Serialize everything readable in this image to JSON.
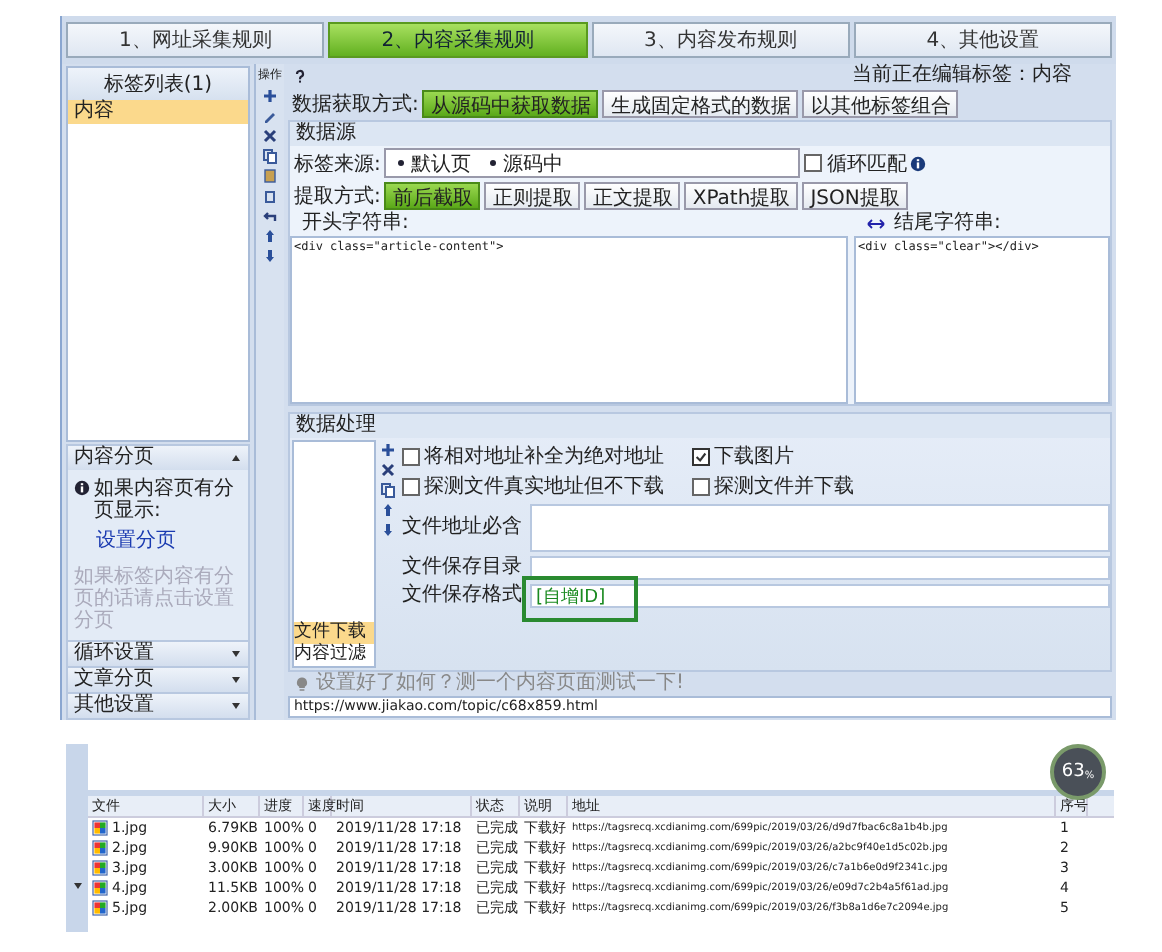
{
  "steps": [
    {
      "label": "1、网址采集规则",
      "selected": false
    },
    {
      "label": "2、内容采集规则",
      "selected": true
    },
    {
      "label": "3、内容发布规则",
      "selected": false
    },
    {
      "label": "4、其他设置",
      "selected": false
    }
  ],
  "tag_list": {
    "title": "标签列表(1)",
    "items": [
      {
        "label": "内容",
        "selected": true
      }
    ]
  },
  "toolbar_label": "操作",
  "editing_status": "当前正在编辑标签：内容",
  "data_mode": {
    "label": "数据获取方式:",
    "options": [
      {
        "label": "从源码中获取数据",
        "selected": true
      },
      {
        "label": "生成固定格式的数据",
        "selected": false
      },
      {
        "label": "以其他标签组合",
        "selected": false
      }
    ]
  },
  "data_source": {
    "title": "数据源",
    "source_label": "标签来源:",
    "sources": [
      "默认页",
      "源码中"
    ],
    "loop_match": {
      "label": "循环匹配",
      "checked": false
    },
    "extract_label": "提取方式:",
    "methods": [
      {
        "label": "前后截取",
        "selected": true
      },
      {
        "label": "正则提取",
        "selected": false
      },
      {
        "label": "正文提取",
        "selected": false
      },
      {
        "label": "XPath提取",
        "selected": false
      },
      {
        "label": "JSON提取",
        "selected": false
      }
    ],
    "start": {
      "label": "开头字符串:",
      "value": "<div class=\"article-content\">"
    },
    "end": {
      "label": "结尾字符串:",
      "value": "<div class=\"clear\"></div>"
    }
  },
  "processing": {
    "title": "数据处理",
    "items": [
      {
        "label": "文件下载",
        "selected": true
      },
      {
        "label": "内容过滤",
        "selected": false
      }
    ],
    "options": [
      {
        "label": "将相对地址补全为绝对地址",
        "checked": false
      },
      {
        "label": "下载图片",
        "checked": true
      },
      {
        "label": "探测文件真实地址但不下载",
        "checked": false
      },
      {
        "label": "探测文件并下载",
        "checked": false
      }
    ],
    "fields": [
      {
        "label": "文件地址必含",
        "highlighted": false
      },
      {
        "label": "文件保存目录",
        "highlighted": false
      },
      {
        "label": "文件保存格式",
        "value": "[自增ID]",
        "highlighted": true
      }
    ]
  },
  "pagination": {
    "title": "内容分页",
    "info": "如果内容页有分页显示:",
    "link": "设置分页",
    "note": "如果标签内容有分页的话请点击设置分页"
  },
  "collapsed_sections": [
    "循环设置",
    "文章分页",
    "其他设置"
  ],
  "test_hint": "设置好了如何？测一个内容页面测试一下!",
  "test_url": "https://www.jiakao.com/topic/c68x859.html",
  "downloads": {
    "columns": [
      "文件",
      "大小",
      "进度",
      "速度",
      "时间",
      "状态",
      "说明",
      "地址",
      "序号"
    ],
    "rows": [
      {
        "cells": [
          "1.jpg",
          "6.79KB",
          "100%",
          "0",
          "2019/11/28 17:18",
          "已完成",
          "下载好",
          "https://tagsrecq.xcdianimg.com/699pic/2019/03/26/d9d7fbac6c8a1b4b.jpg",
          "1"
        ]
      },
      {
        "cells": [
          "2.jpg",
          "9.90KB",
          "100%",
          "0",
          "2019/11/28 17:18",
          "已完成",
          "下载好",
          "https://tagsrecq.xcdianimg.com/699pic/2019/03/26/a2bc9f40e1d5c02b.jpg",
          "2"
        ]
      },
      {
        "cells": [
          "3.jpg",
          "3.00KB",
          "100%",
          "0",
          "2019/11/28 17:18",
          "已完成",
          "下载好",
          "https://tagsrecq.xcdianimg.com/699pic/2019/03/26/c7a1b6e0d9f2341c.jpg",
          "3"
        ]
      },
      {
        "cells": [
          "4.jpg",
          "11.5KB",
          "100%",
          "0",
          "2019/11/28 17:18",
          "已完成",
          "下载好",
          "https://tagsrecq.xcdianimg.com/699pic/2019/03/26/e09d7c2b4a5f61ad.jpg",
          "4"
        ]
      },
      {
        "cells": [
          "5.jpg",
          "2.00KB",
          "100%",
          "0",
          "2019/11/28 17:18",
          "已完成",
          "下载好",
          "https://tagsrecq.xcdianimg.com/699pic/2019/03/26/f3b8a1d6e7c2094e.jpg",
          "5"
        ]
      }
    ]
  },
  "speed_badge": {
    "value": "63",
    "unit": "%"
  }
}
